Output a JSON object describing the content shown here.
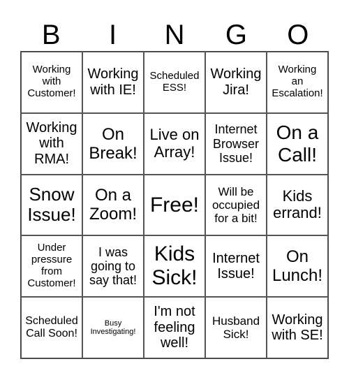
{
  "header": [
    "B",
    "I",
    "N",
    "G",
    "O"
  ],
  "cells": [
    "Working\nwith\nCustomer!",
    "Working\nwith IE!",
    "Scheduled\nESS!",
    "Working\nJira!",
    "Working\nan\nEscalation!",
    "Working\nwith\nRMA!",
    "On\nBreak!",
    "Live on\nArray!",
    "Internet\nBrowser\nIssue!",
    "On a\nCall!",
    "Snow\nIssue!",
    "On a\nZoom!",
    "Free!",
    "Will be\noccupied\nfor a bit!",
    "Kids\nerrand!",
    "Under\npressure\nfrom\nCustomer!",
    "I was\ngoing to\nsay that!",
    "Kids\nSick!",
    "Internet\nIssue!",
    "On\nLunch!",
    "Scheduled\nCall Soon!",
    "Busy\nInvestigating!",
    "I'm not\nfeeling\nwell!",
    "Husband\nSick!",
    "Working\nwith SE!"
  ]
}
